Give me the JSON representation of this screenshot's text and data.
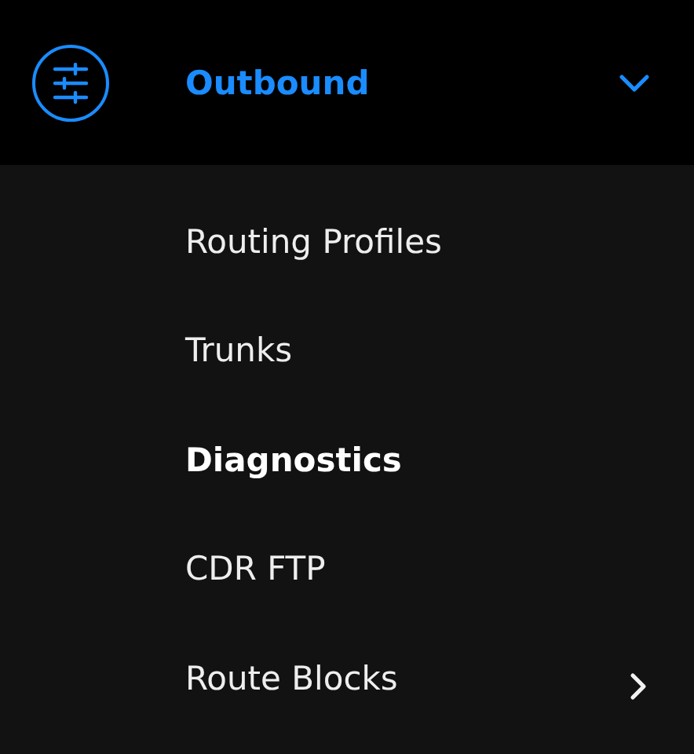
{
  "header": {
    "title": "Outbound",
    "expanded": true
  },
  "items": [
    {
      "label": "Routing Profiles",
      "selected": false,
      "has_submenu": false
    },
    {
      "label": "Trunks",
      "selected": false,
      "has_submenu": false
    },
    {
      "label": "Diagnostics",
      "selected": true,
      "has_submenu": false
    },
    {
      "label": "CDR FTP",
      "selected": false,
      "has_submenu": false
    },
    {
      "label": "Route Blocks",
      "selected": false,
      "has_submenu": true
    }
  ]
}
